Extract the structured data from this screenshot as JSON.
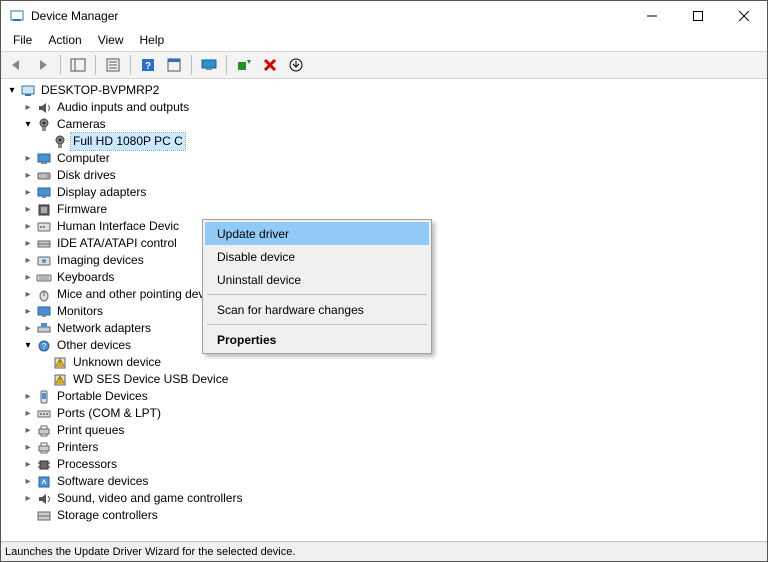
{
  "window": {
    "title": "Device Manager"
  },
  "menu": {
    "items": [
      "File",
      "Action",
      "View",
      "Help"
    ]
  },
  "tree": {
    "root": "DESKTOP-BVPMRP2",
    "nodes": [
      {
        "label": "Audio inputs and outputs",
        "icon": "audio-icon",
        "expanded": false
      },
      {
        "label": "Cameras",
        "icon": "camera-icon",
        "expanded": true,
        "children": [
          {
            "label": "Full HD 1080P PC C",
            "icon": "camera-icon",
            "selected": true
          }
        ]
      },
      {
        "label": "Computer",
        "icon": "computer-icon",
        "expanded": false
      },
      {
        "label": "Disk drives",
        "icon": "disk-icon",
        "expanded": false
      },
      {
        "label": "Display adapters",
        "icon": "display-icon",
        "expanded": false
      },
      {
        "label": "Firmware",
        "icon": "firmware-icon",
        "expanded": false
      },
      {
        "label": "Human Interface Devic",
        "icon": "hid-icon",
        "expanded": false
      },
      {
        "label": "IDE ATA/ATAPI control",
        "icon": "ide-icon",
        "expanded": false
      },
      {
        "label": "Imaging devices",
        "icon": "imaging-icon",
        "expanded": false
      },
      {
        "label": "Keyboards",
        "icon": "keyboard-icon",
        "expanded": false
      },
      {
        "label": "Mice and other pointing devices",
        "icon": "mouse-icon",
        "expanded": false
      },
      {
        "label": "Monitors",
        "icon": "monitor-icon",
        "expanded": false
      },
      {
        "label": "Network adapters",
        "icon": "network-icon",
        "expanded": false
      },
      {
        "label": "Other devices",
        "icon": "other-icon",
        "expanded": true,
        "children": [
          {
            "label": "Unknown device",
            "icon": "warn-icon"
          },
          {
            "label": "WD SES Device USB Device",
            "icon": "warn-icon"
          }
        ]
      },
      {
        "label": "Portable Devices",
        "icon": "portable-icon",
        "expanded": false
      },
      {
        "label": "Ports (COM & LPT)",
        "icon": "ports-icon",
        "expanded": false
      },
      {
        "label": "Print queues",
        "icon": "printq-icon",
        "expanded": false
      },
      {
        "label": "Printers",
        "icon": "printer-icon",
        "expanded": false
      },
      {
        "label": "Processors",
        "icon": "processor-icon",
        "expanded": false
      },
      {
        "label": "Software devices",
        "icon": "software-icon",
        "expanded": false
      },
      {
        "label": "Sound, video and game controllers",
        "icon": "sound-icon",
        "expanded": false
      },
      {
        "label": "Storage controllers",
        "icon": "storage-icon",
        "expanded": null
      }
    ]
  },
  "context_menu": {
    "items": [
      {
        "label": "Update driver",
        "highlight": true
      },
      {
        "label": "Disable device"
      },
      {
        "label": "Uninstall device"
      },
      {
        "separator": true
      },
      {
        "label": "Scan for hardware changes"
      },
      {
        "separator": true
      },
      {
        "label": "Properties",
        "bold": true
      }
    ]
  },
  "statusbar": {
    "text": "Launches the Update Driver Wizard for the selected device."
  }
}
